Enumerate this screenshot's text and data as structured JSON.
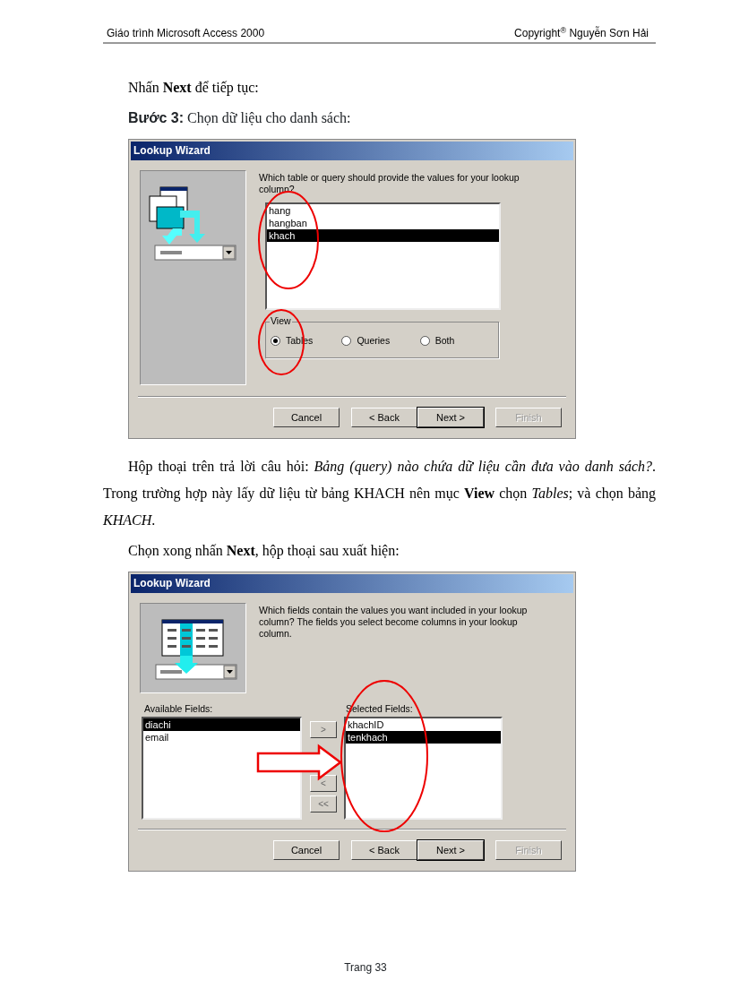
{
  "header": {
    "left": "Giáo trình Microsoft Access 2000",
    "right": "Copyright$^{®}$ Nguyễn Sơn Hải"
  },
  "blocks": [
    {
      "kind": "paragraph",
      "text": "Nhấn **Next** để tiếp tục:"
    },
    {
      "kind": "step",
      "text": "**Bước 3:** Chọn dữ liệu cho danh sách:"
    },
    {
      "kind": "dialog",
      "dialog": {
        "kind": "table_picker",
        "title": "Lookup Wizard",
        "prompt": "Which table or query should provide the values for your lookup column?",
        "list": [
          {
            "label": "hang",
            "selected": false
          },
          {
            "label": "hangban",
            "selected": false
          },
          {
            "label": "khach",
            "selected": true
          }
        ],
        "view": {
          "label": "View",
          "options": [
            {
              "label": "Tables",
              "selected": true
            },
            {
              "label": "Queries",
              "selected": false
            },
            {
              "label": "Both",
              "selected": false
            }
          ]
        },
        "buttons": [
          {
            "label": "Cancel",
            "default": false,
            "disabled": false
          },
          {
            "label": "< Back",
            "default": false,
            "disabled": false
          },
          {
            "label": "Next >",
            "default": true,
            "disabled": false
          },
          {
            "label": "Finish",
            "default": false,
            "disabled": true
          }
        ]
      }
    },
    {
      "kind": "paragraph",
      "text": "Hộp thoại trên trả lời câu hỏi: *Bảng (query) nào chứa dữ liệu cần đưa vào danh sách?*. Trong trường hợp này lấy dữ liệu từ bảng KHACH nên mục **View** chọn *Tables*; và chọn bảng *KHACH*."
    },
    {
      "kind": "paragraph",
      "text": "Chọn xong nhấn **Next**, hộp thoại sau xuất hiện:"
    },
    {
      "kind": "dialog",
      "dialog": {
        "kind": "field_picker",
        "title": "Lookup Wizard",
        "prompt": "Which fields contain the values you want included in your lookup column? The fields you select become columns in your lookup column.",
        "available": {
          "label": "Available Fields:",
          "items": [
            {
              "label": "diachi",
              "selected": true
            },
            {
              "label": "email",
              "selected": false
            }
          ]
        },
        "move_buttons": [
          {
            "kind": "labeled",
            "label": ">"
          },
          {
            "kind": "labeled",
            "label": "<"
          },
          {
            "kind": "labeled",
            "label": "<<"
          }
        ],
        "chosen": {
          "label": "Selected Fields:",
          "items": [
            {
              "label": "khachID",
              "selected": false
            },
            {
              "label": "tenkhach",
              "selected": true
            }
          ]
        },
        "buttons": [
          {
            "label": "Cancel",
            "default": false,
            "disabled": false
          },
          {
            "label": "< Back",
            "default": false,
            "disabled": false
          },
          {
            "label": "Next >",
            "default": true,
            "disabled": false
          },
          {
            "label": "Finish",
            "default": false,
            "disabled": true
          }
        ]
      }
    }
  ],
  "footer": "Trang 33"
}
